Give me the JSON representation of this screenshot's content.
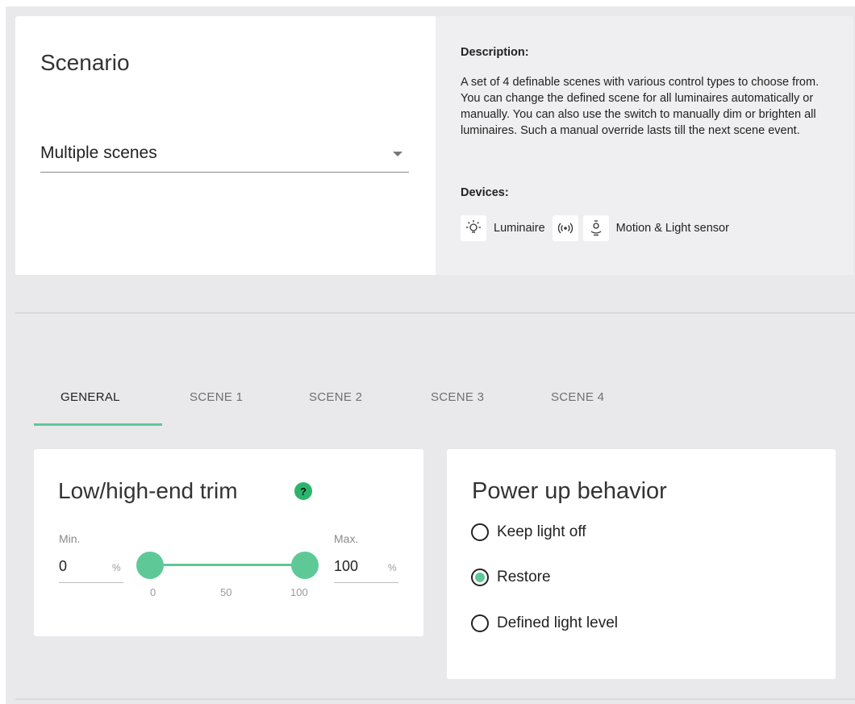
{
  "scenario": {
    "title": "Scenario",
    "selected": "Multiple scenes",
    "description_heading": "Description:",
    "description": "A set of 4 definable scenes with various control types to choose from. You can change the defined scene for all luminaires automatically or manually. You can also use the switch to manually dim or brighten all luminaires. Such a manual override lasts till the next scene event.",
    "devices_heading": "Devices:",
    "devices": [
      {
        "icon": "luminaire-icon",
        "label": "Luminaire"
      },
      {
        "icon": "wireless-switch-icon",
        "label": ""
      },
      {
        "icon": "motion-light-sensor-icon",
        "label": "Motion & Light sensor"
      }
    ]
  },
  "tabs": [
    {
      "label": "GENERAL",
      "active": true
    },
    {
      "label": "SCENE 1",
      "active": false
    },
    {
      "label": "SCENE 2",
      "active": false
    },
    {
      "label": "SCENE 3",
      "active": false
    },
    {
      "label": "SCENE 4",
      "active": false
    }
  ],
  "trim": {
    "title": "Low/high-end trim",
    "help": "?",
    "min_label": "Min.",
    "min_value": "0",
    "max_label": "Max.",
    "max_value": "100",
    "unit": "%",
    "slider_ticks": [
      "0",
      "50",
      "100"
    ],
    "slider_range": [
      0,
      100
    ]
  },
  "power_up": {
    "title": "Power up behavior",
    "options": [
      {
        "label": "Keep light off",
        "selected": false
      },
      {
        "label": "Restore",
        "selected": true
      },
      {
        "label": "Defined light level",
        "selected": false
      }
    ]
  },
  "colors": {
    "accent": "#5ec997",
    "help_badge": "#2ab56b",
    "background": "#e9e9ec"
  }
}
